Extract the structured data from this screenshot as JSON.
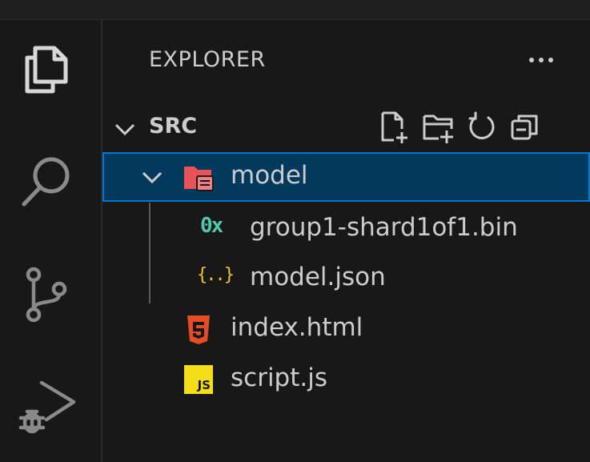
{
  "explorer": {
    "title": "EXPLORER",
    "more_icon": "ellipsis-icon"
  },
  "activity_bar": {
    "items": [
      {
        "name": "explorer",
        "icon": "files-icon"
      },
      {
        "name": "search",
        "icon": "search-icon"
      },
      {
        "name": "source-control",
        "icon": "source-control-icon"
      },
      {
        "name": "run-and-debug",
        "icon": "run-debug-icon"
      }
    ]
  },
  "section": {
    "title": "SRC",
    "actions": [
      "new-file-icon",
      "new-folder-icon",
      "refresh-icon",
      "collapse-all-icon"
    ]
  },
  "tree": [
    {
      "label": "model",
      "type": "folder",
      "expanded": true,
      "selected": true,
      "icon": "folder-model-icon"
    },
    {
      "label": "group1-shard1of1.bin",
      "type": "file",
      "icon": "binary-file-icon",
      "icon_text": "0x"
    },
    {
      "label": "model.json",
      "type": "file",
      "icon": "json-file-icon",
      "icon_text": "{..}"
    },
    {
      "label": "index.html",
      "type": "file",
      "icon": "html-file-icon"
    },
    {
      "label": "script.js",
      "type": "file",
      "icon": "js-file-icon",
      "icon_text": "JS"
    }
  ],
  "colors": {
    "background": "#181818",
    "selection": "#04395e",
    "focus_border": "#0078d4",
    "text": "#cccccc",
    "folder": "#e8535a",
    "binary": "#4ec9b0",
    "json": "#f1c232",
    "html": "#e44d26",
    "js": "#f5de19"
  }
}
